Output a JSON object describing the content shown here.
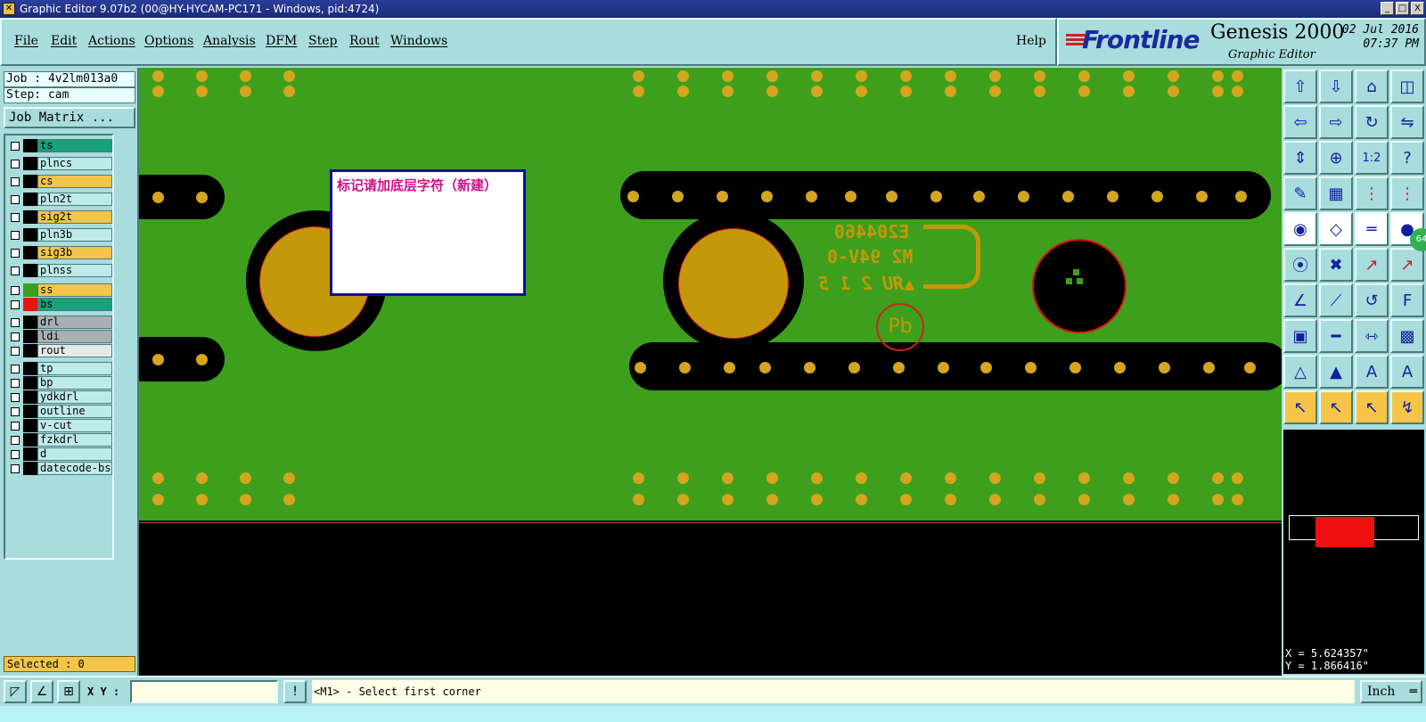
{
  "window": {
    "title": "Graphic Editor 9.07b2 (00@HY-HYCAM-PC171 - Windows, pid:4724)",
    "controls": [
      "_",
      "□",
      "X"
    ]
  },
  "menu": {
    "file": "File",
    "edit": "Edit",
    "actions": "Actions",
    "options": "Options",
    "analysis": "Analysis",
    "dfm": "DFM",
    "step": "Step",
    "rout": "Rout",
    "windows": "Windows",
    "help": "Help"
  },
  "brand": {
    "logo": "Frontline",
    "product": "Genesis 2000",
    "subtitle": "Graphic Editor",
    "date": "02 Jul 2016",
    "time": "07:37 PM"
  },
  "job": {
    "job_label": "Job : 4v2lm013a0",
    "step_label": "Step: cam",
    "matrix_button": "Job Matrix ...",
    "selected": "Selected : 0"
  },
  "layers": [
    {
      "name": "ts",
      "color": "#1aa07a",
      "swatch": "#000000"
    },
    {
      "name": "plncs",
      "color": "#bfeaea",
      "swatch": "#000000"
    },
    {
      "name": "cs",
      "color": "#f4c548",
      "swatch": "#000000"
    },
    {
      "name": "pln2t",
      "color": "#bfeaea",
      "swatch": "#000000"
    },
    {
      "name": "sig2t",
      "color": "#f4c548",
      "swatch": "#000000"
    },
    {
      "name": "pln3b",
      "color": "#bfeaea",
      "swatch": "#000000"
    },
    {
      "name": "sig3b",
      "color": "#f4c548",
      "swatch": "#000000"
    },
    {
      "name": "plnss",
      "color": "#bfeaea",
      "swatch": "#000000"
    },
    {
      "name": "ss",
      "color": "#f4c548",
      "swatch": "#3d9f1c"
    },
    {
      "name": "bs",
      "color": "#1aa07a",
      "swatch": "#f01010"
    },
    {
      "name": "drl",
      "color": "#a8b0b4",
      "swatch": "#000000"
    },
    {
      "name": "ldi",
      "color": "#a8b0b4",
      "swatch": "#000000"
    },
    {
      "name": "rout",
      "color": "#e8e8e8",
      "swatch": "#000000"
    },
    {
      "name": "tp",
      "color": "#bfeaea",
      "swatch": "#000000"
    },
    {
      "name": "bp",
      "color": "#bfeaea",
      "swatch": "#000000"
    },
    {
      "name": "ydkdrl",
      "color": "#bfeaea",
      "swatch": "#000000"
    },
    {
      "name": "outline",
      "color": "#bfeaea",
      "swatch": "#000000"
    },
    {
      "name": "v-cut",
      "color": "#bfeaea",
      "swatch": "#000000"
    },
    {
      "name": "fzkdrl",
      "color": "#bfeaea",
      "swatch": "#000000"
    },
    {
      "name": "d",
      "color": "#bfeaea",
      "swatch": "#000000"
    },
    {
      "name": "datecode-bs",
      "color": "#bfeaea",
      "swatch": "#000000"
    }
  ],
  "canvas": {
    "note": "标记请加底层字符（新建）",
    "silk_code": "E204460",
    "silk_rating": "M2 94V-0",
    "silk_ul": "▲ЯU 2 1 5",
    "silk_pb": "Pb"
  },
  "tools": [
    "move-top-icon",
    "move-bottom-icon",
    "home-icon",
    "split-icon",
    "move-left-icon",
    "move-right-icon",
    "rotate-icon",
    "mirror-icon",
    "fit-vertical-icon",
    "fit-all-icon",
    "ratio-icon",
    "help-icon",
    "measure-icon",
    "grid-icon",
    "layer-net-icon",
    "layer-net2-icon",
    "snap-icon",
    "eraser-icon",
    "ruler-icon",
    "circle-icon",
    "connect-icon",
    "cross-icon",
    "line-point-icon",
    "line-point2-icon",
    "angle-icon",
    "slope-icon",
    "arc-icon",
    "font-icon",
    "pad-add-icon",
    "line-add-icon",
    "dimension-icon",
    "surface-icon",
    "triangle-icon",
    "triangle-up-icon",
    "triangle-a-icon",
    "triangle-b-icon",
    "pointer-icon",
    "pointer-select-icon",
    "pointer-edit-icon",
    "pointer-route-icon"
  ],
  "tool_glyphs": [
    "⇧",
    "⇩",
    "⌂",
    "◫",
    "⇦",
    "⇨",
    "↻",
    "⇋",
    "⇕",
    "⊕",
    "1:2",
    "?",
    "✎",
    "▦",
    "⋮",
    "⋮",
    "◉",
    "◇",
    "═",
    "●",
    "⦿",
    "✖",
    "↗",
    "↗",
    "∠",
    "⟋",
    "↺",
    "F",
    "▣",
    "━",
    "⇿",
    "▩",
    "△",
    "▲",
    "A",
    "A",
    "↖",
    "↖",
    "↖",
    "↯"
  ],
  "badge": "64",
  "coords": {
    "x": "X = 5.624357\"",
    "y": "Y = 1.866416\""
  },
  "bottom": {
    "xy_label": "X Y :",
    "xy_value": "",
    "prompt": "<M1> - Select first corner",
    "unit": "Inch"
  }
}
